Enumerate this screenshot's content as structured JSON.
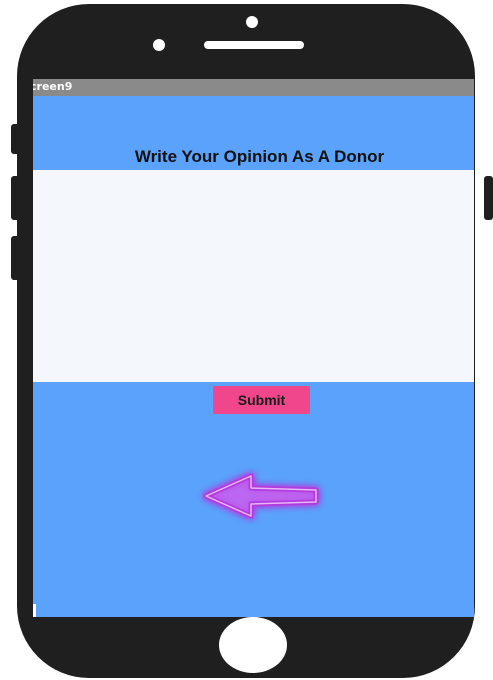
{
  "window": {
    "title": "creen9"
  },
  "main": {
    "heading": "Write Your Opinion As A Donor",
    "opinion_input": {
      "value": "",
      "placeholder": ""
    },
    "submit_label": "Submit"
  },
  "icons": {
    "back": "left-arrow-icon"
  },
  "colors": {
    "screen_background": "#5aa2fb",
    "title_bar": "#8a8a8a",
    "text_area": "#f4f8fd",
    "submit_button": "#f0478c",
    "arrow_glow": "#b23adf",
    "phone_frame": "#1f1f1f"
  }
}
